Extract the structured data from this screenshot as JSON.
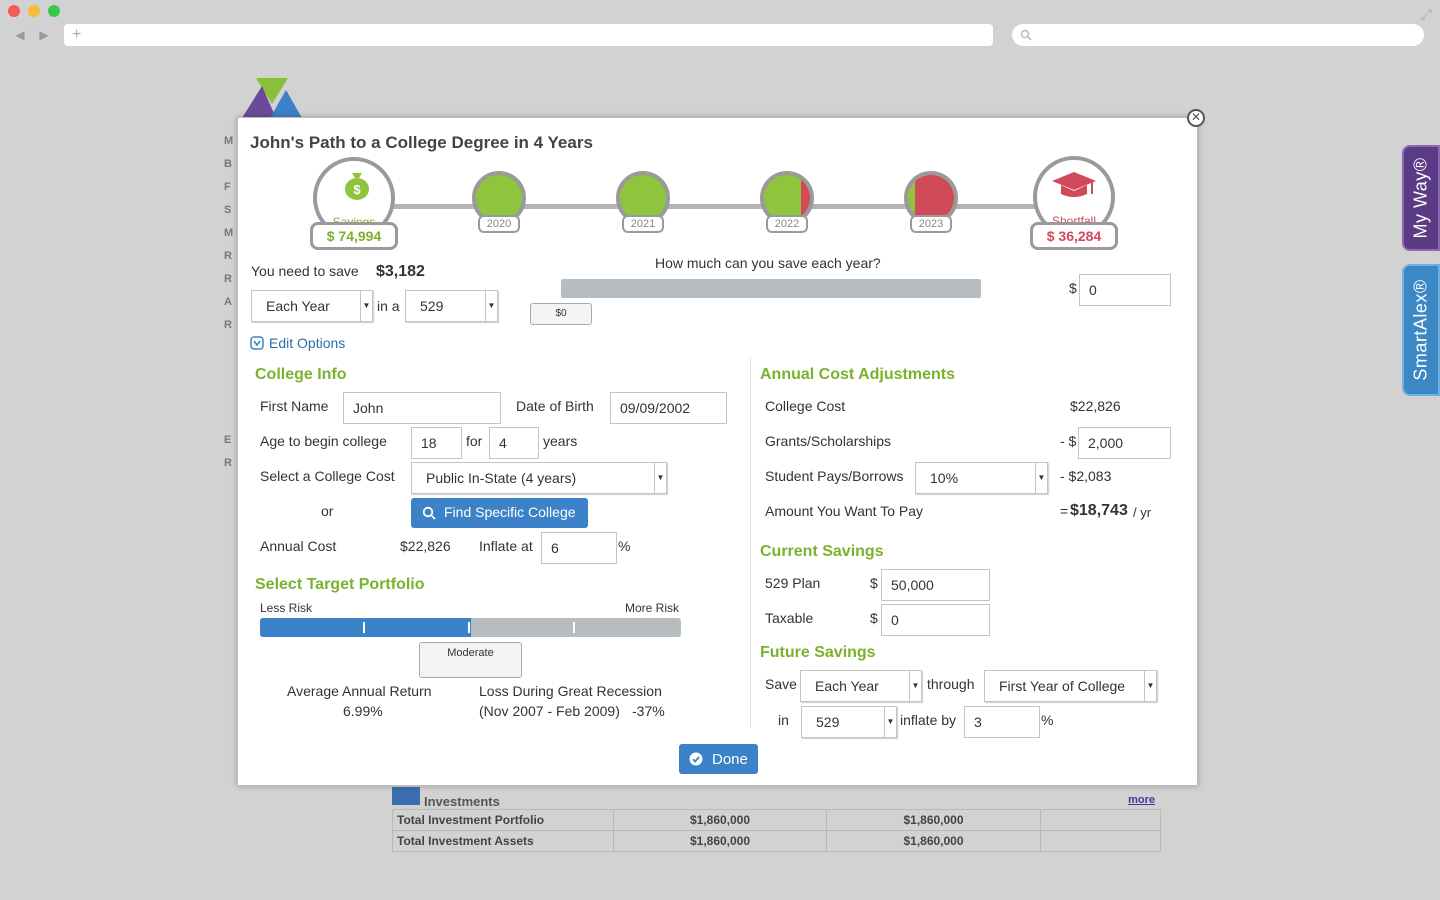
{
  "browser": {
    "back_icon": "◀",
    "forward_icon": "▶",
    "new_tab_icon": "+",
    "expand_icon": "⤢"
  },
  "background": {
    "left_letters": [
      "M",
      "B",
      "F",
      "S",
      "M",
      "R",
      "R",
      "A",
      "R",
      "",
      "",
      "",
      "",
      "E",
      "R"
    ],
    "side_tabs": {
      "my_way": "My Way®",
      "smartalex": "SmartAlex®"
    },
    "investments": {
      "title": "Investments",
      "more": "more",
      "rows": [
        {
          "label": "Total Investment Portfolio",
          "col1": "$1,860,000",
          "col2": "$1,860,000",
          "col3": ""
        },
        {
          "label": "Total Investment Assets",
          "col1": "$1,860,000",
          "col2": "$1,860,000",
          "col3": ""
        }
      ]
    }
  },
  "modal": {
    "title": "John's Path to a College Degree in 4 Years",
    "close_icon": "✕",
    "timeline": {
      "start": {
        "label": "Savings",
        "amount": "$ 74,994",
        "color": "#8fc43d"
      },
      "years": [
        {
          "year": "2020",
          "shortfall_fraction": 0
        },
        {
          "year": "2021",
          "shortfall_fraction": 0
        },
        {
          "year": "2022",
          "shortfall_fraction": 0.2
        },
        {
          "year": "2023",
          "shortfall_fraction": 0.85
        }
      ],
      "end": {
        "label": "Shortfall",
        "amount": "$ 36,284",
        "color": "#d14a5a"
      }
    },
    "need_to_save": {
      "label": "You need to save",
      "amount": "$3,182",
      "frequency": "Each Year",
      "in_a": "in a",
      "account": "529"
    },
    "slider": {
      "question": "How much can you save each year?",
      "handle_label": "$0",
      "dollar": "$",
      "value": "0"
    },
    "edit_options": "Edit Options",
    "college_info": {
      "title": "College Info",
      "first_name_label": "First Name",
      "first_name": "John",
      "dob_label": "Date of Birth",
      "dob": "09/09/2002",
      "age_label": "Age to begin college",
      "age": "18",
      "for": "for",
      "years_count": "4",
      "years": "years",
      "cost_label": "Select a College Cost",
      "cost_option": "Public In-State (4 years)",
      "or": "or",
      "find_button": "Find Specific College",
      "annual_cost_label": "Annual Cost",
      "annual_cost": "$22,826",
      "inflate_label": "Inflate at",
      "inflate_value": "6",
      "percent": "%"
    },
    "portfolio": {
      "title": "Select Target Portfolio",
      "less_risk": "Less Risk",
      "more_risk": "More Risk",
      "level": 0.5,
      "handle_label": "Moderate",
      "avg_return_label": "Average Annual Return",
      "avg_return": "6.99%",
      "loss_label": "Loss During Great Recession",
      "loss_period": "(Nov 2007 - Feb 2009)",
      "loss_value": "-37%"
    },
    "annual_cost_adjustments": {
      "title": "Annual Cost Adjustments",
      "college_cost_label": "College Cost",
      "college_cost": "$22,826",
      "grants_label": "Grants/Scholarships",
      "grants_prefix": "- $",
      "grants": "2,000",
      "student_label": "Student Pays/Borrows",
      "student_pct": "10%",
      "student_amount": "- $2,083",
      "want_label": "Amount You Want To Pay",
      "want_prefix": "=",
      "want_amount": "$18,743",
      "want_suffix": "/ yr"
    },
    "current_savings": {
      "title": "Current Savings",
      "plan_label": "529 Plan",
      "plan_value": "50,000",
      "taxable_label": "Taxable",
      "taxable_value": "0",
      "dollar": "$"
    },
    "future_savings": {
      "title": "Future Savings",
      "save_label": "Save",
      "frequency": "Each Year",
      "through_label": "through",
      "through_value": "First Year of College",
      "in_label": "in",
      "account": "529",
      "inflate_label": "inflate by",
      "inflate_value": "3",
      "percent": "%"
    },
    "done_button": "Done"
  }
}
